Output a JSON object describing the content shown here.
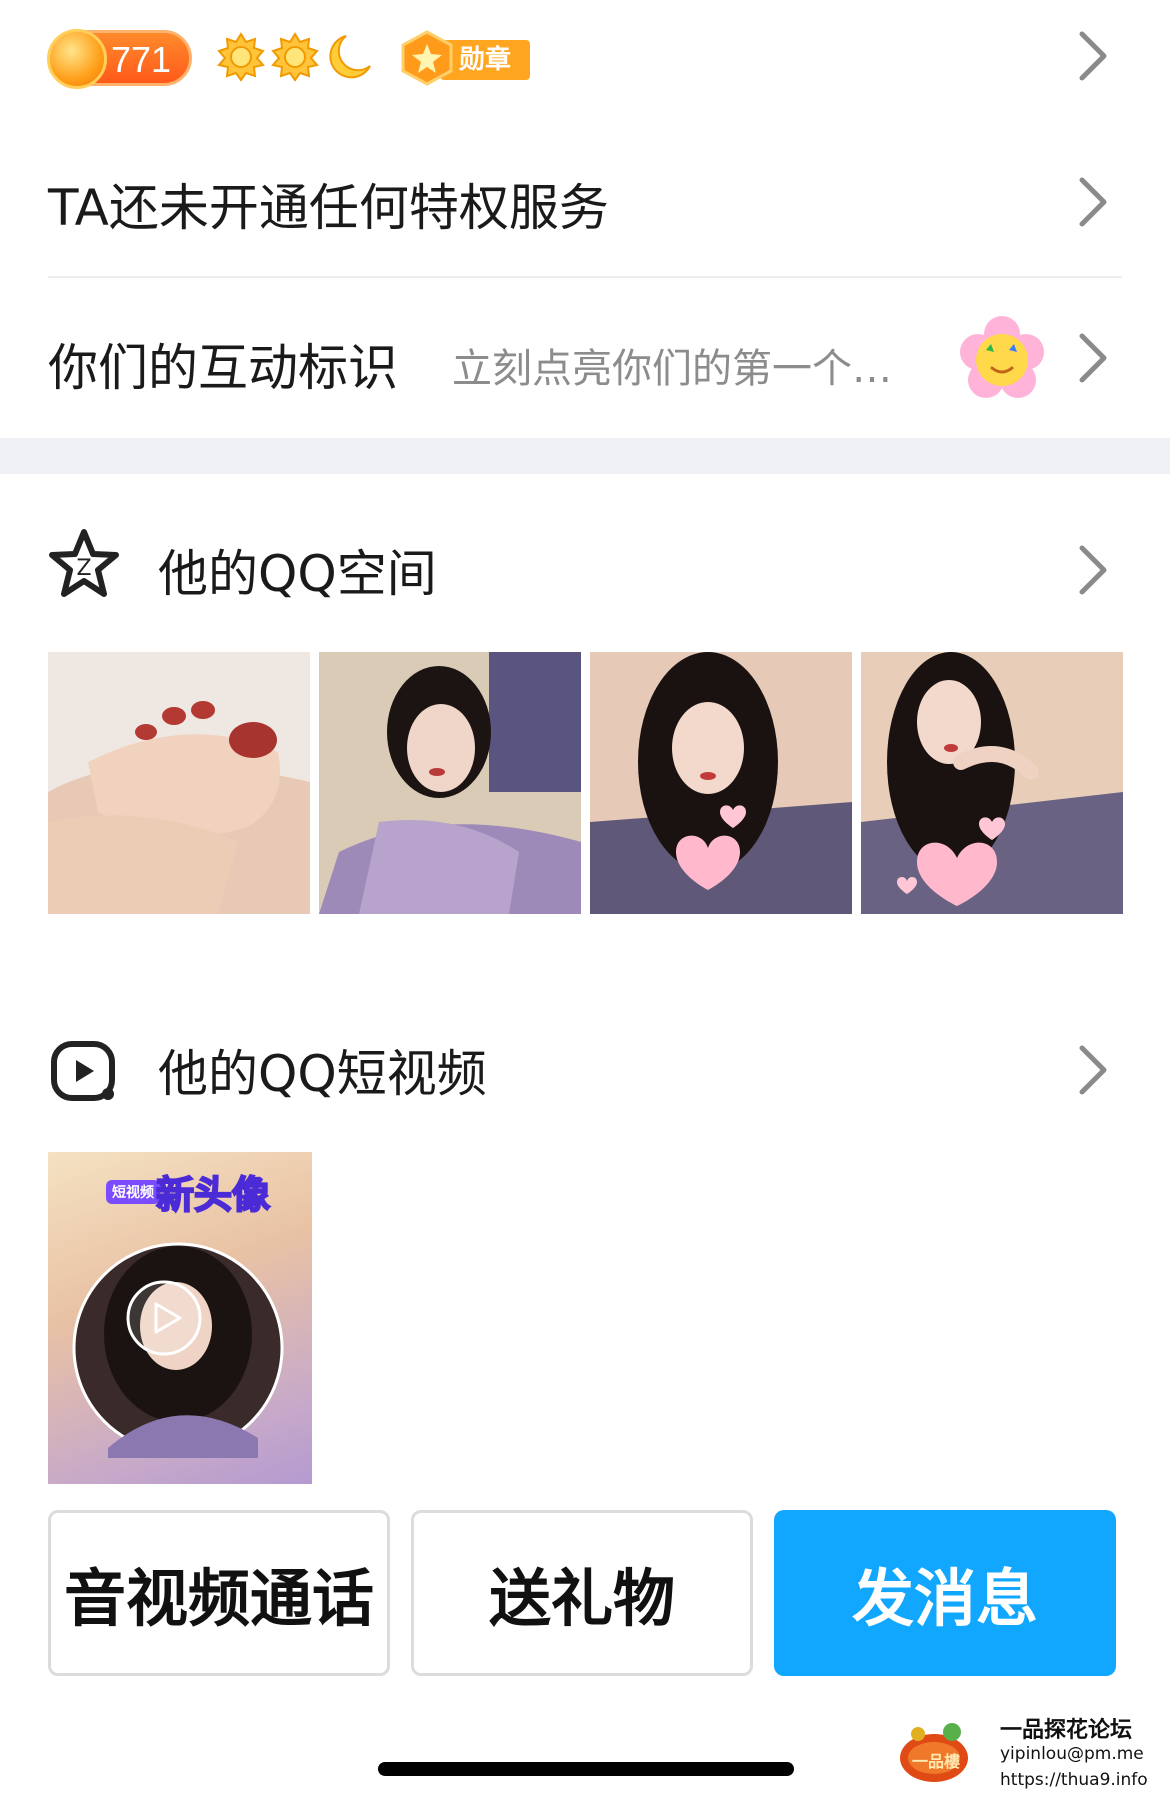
{
  "status": {
    "coin_count": "771",
    "medal_label": "勋章"
  },
  "privilege": {
    "label": "TA还未开通任何特权服务"
  },
  "interaction": {
    "label": "你们的互动标识",
    "hint": "立刻点亮你们的第一个…"
  },
  "qzone": {
    "title": "他的QQ空间",
    "photos": [
      "photo-feet",
      "photo-blanket",
      "photo-heart-1",
      "photo-heart-2"
    ]
  },
  "short_video": {
    "title": "他的QQ短视频",
    "cover_tag": "短视频",
    "cover_title": "新头像"
  },
  "actions": {
    "call": "音视频通话",
    "gift": "送礼物",
    "message": "发消息"
  },
  "watermark": {
    "logo_text": "一品樓",
    "title": "一品探花论坛",
    "email": "yipinlou@pm.me",
    "url": "https://thua9.info"
  },
  "colors": {
    "primary": "#12a7ff",
    "coin_orange": "#ff6a1f",
    "divider": "#ececec",
    "section_gap": "#eef0f3"
  }
}
